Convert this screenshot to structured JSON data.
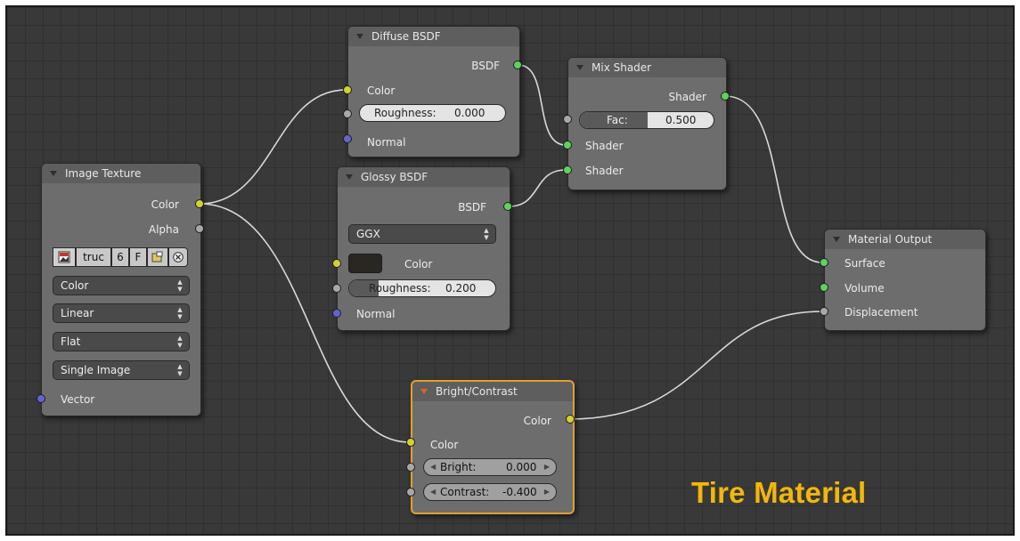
{
  "editor": {
    "caption": "Tire Material"
  },
  "nodes": {
    "diffuse": {
      "title": "Diffuse BSDF",
      "out_bsdf": "BSDF",
      "in_color": "Color",
      "roughness_label": "Roughness:",
      "roughness_value": "0.000",
      "in_normal": "Normal"
    },
    "mix": {
      "title": "Mix Shader",
      "out_shader": "Shader",
      "fac_label": "Fac:",
      "fac_value": "0.500",
      "in_shader1": "Shader",
      "in_shader2": "Shader"
    },
    "image": {
      "title": "Image Texture",
      "out_color": "Color",
      "out_alpha": "Alpha",
      "image_name": "truc",
      "users": "6",
      "fake_user": "F",
      "color_space": "Color",
      "interpolation": "Linear",
      "projection": "Flat",
      "source": "Single Image",
      "in_vector": "Vector"
    },
    "glossy": {
      "title": "Glossy BSDF",
      "out_bsdf": "BSDF",
      "distribution": "GGX",
      "in_color": "Color",
      "roughness_label": "Roughness:",
      "roughness_value": "0.200",
      "in_normal": "Normal"
    },
    "output": {
      "title": "Material Output",
      "in_surface": "Surface",
      "in_volume": "Volume",
      "in_displacement": "Displacement"
    },
    "bright": {
      "title": "Bright/Contrast",
      "out_color": "Color",
      "in_color": "Color",
      "bright_label": "Bright:",
      "bright_value": "0.000",
      "contrast_label": "Contrast:",
      "contrast_value": "-0.400"
    }
  },
  "colors": {
    "shader_socket": "#5fd25f",
    "color_socket": "#d2d231",
    "value_socket": "#a8a8a8",
    "vector_socket": "#6464d0",
    "active_border": "#e0a030",
    "caption": "#f2b70c"
  }
}
